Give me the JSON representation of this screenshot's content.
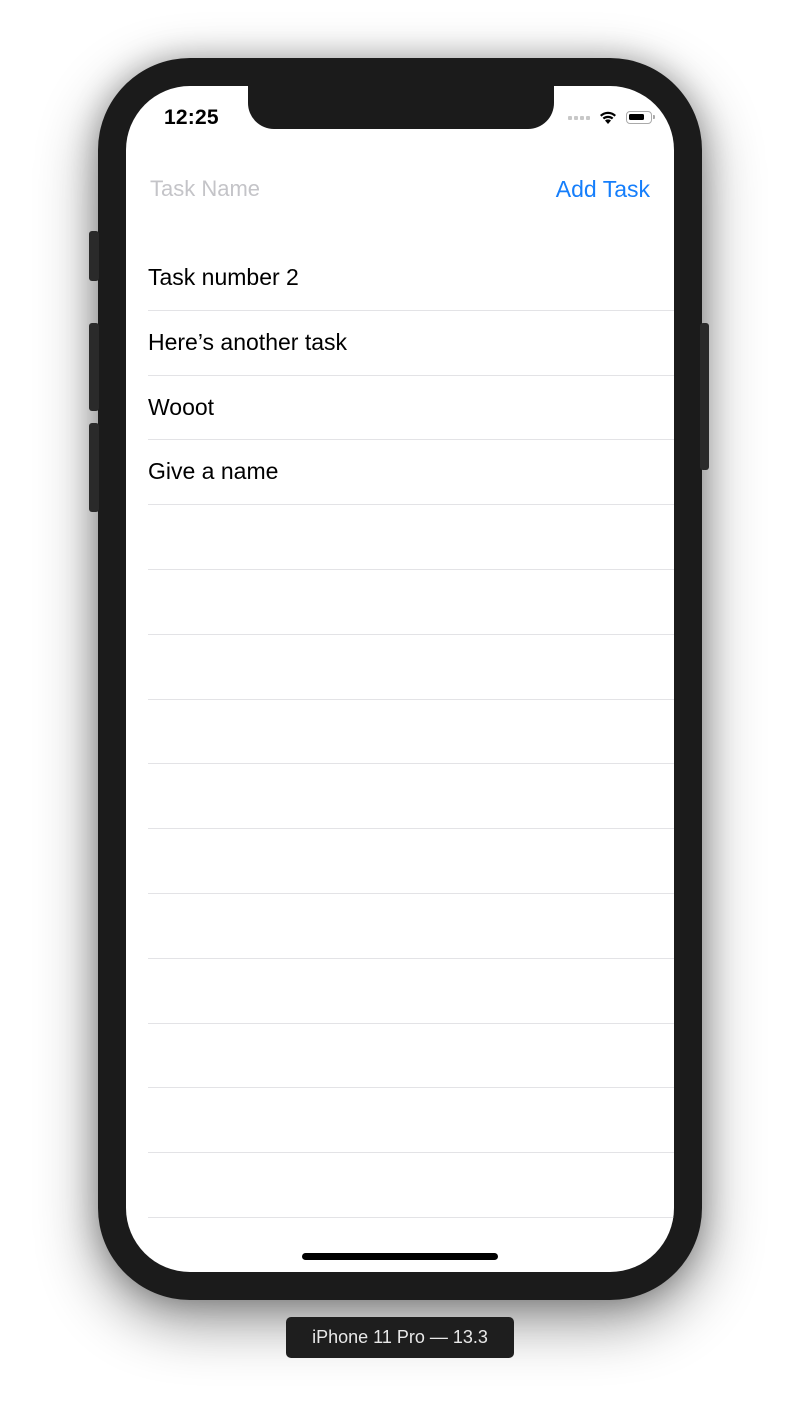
{
  "status_bar": {
    "time": "12:25",
    "icons": [
      "signal-dots-icon",
      "wifi-icon",
      "battery-icon"
    ]
  },
  "input_row": {
    "task_input_value": "",
    "task_input_placeholder": "Task Name",
    "add_task_label": "Add Task",
    "accent_color": "#157efb"
  },
  "tasks": [
    {
      "label": "Task number 2"
    },
    {
      "label": "Here’s another task"
    },
    {
      "label": "Wooot"
    },
    {
      "label": "Give a name"
    },
    {
      "label": ""
    },
    {
      "label": ""
    },
    {
      "label": ""
    },
    {
      "label": ""
    },
    {
      "label": ""
    },
    {
      "label": ""
    },
    {
      "label": ""
    },
    {
      "label": ""
    },
    {
      "label": ""
    },
    {
      "label": ""
    },
    {
      "label": ""
    }
  ],
  "simulator": {
    "device_label": "iPhone 11 Pro — 13.3"
  }
}
